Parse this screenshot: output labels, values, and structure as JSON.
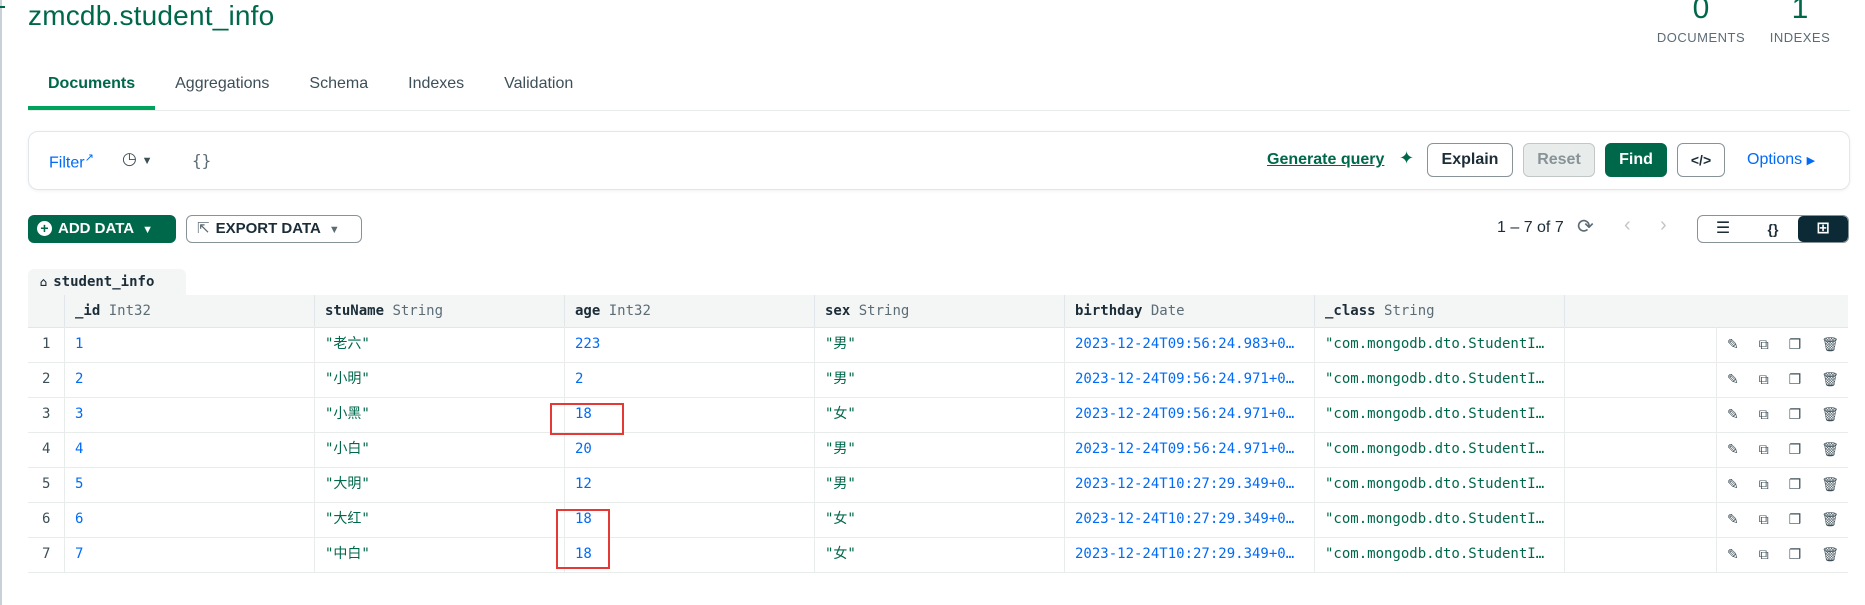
{
  "header": {
    "title": "zmcdb.student_info",
    "documents_count": "0",
    "documents_label": "DOCUMENTS",
    "indexes_count": "1",
    "indexes_label": "INDEXES"
  },
  "tabs": [
    {
      "label": "Documents",
      "active": true
    },
    {
      "label": "Aggregations"
    },
    {
      "label": "Schema"
    },
    {
      "label": "Indexes"
    },
    {
      "label": "Validation"
    }
  ],
  "querybar": {
    "filter_label": "Filter",
    "filter_value": "{}",
    "generate_query": "Generate query",
    "explain": "Explain",
    "reset": "Reset",
    "find": "Find",
    "options": "Options"
  },
  "toolbar": {
    "add_data": "ADD DATA",
    "export_data": "EXPORT DATA",
    "pagination": "1 – 7 of 7"
  },
  "grid": {
    "collection_tab": "student_info",
    "columns": [
      {
        "name": "_id",
        "type": "Int32"
      },
      {
        "name": "stuName",
        "type": "String"
      },
      {
        "name": "age",
        "type": "Int32"
      },
      {
        "name": "sex",
        "type": "String"
      },
      {
        "name": "birthday",
        "type": "Date"
      },
      {
        "name": "_class",
        "type": "String"
      }
    ],
    "rows": [
      {
        "idx": "1",
        "id": "1",
        "name": "\"老六\"",
        "age": "223",
        "sex": "\"男\"",
        "birthday": "2023-12-24T09:56:24.983+0…",
        "class": "\"com.mongodb.dto.StudentI…"
      },
      {
        "idx": "2",
        "id": "2",
        "name": "\"小明\"",
        "age": "2",
        "sex": "\"男\"",
        "birthday": "2023-12-24T09:56:24.971+0…",
        "class": "\"com.mongodb.dto.StudentI…"
      },
      {
        "idx": "3",
        "id": "3",
        "name": "\"小黑\"",
        "age": "18",
        "sex": "\"女\"",
        "birthday": "2023-12-24T09:56:24.971+0…",
        "class": "\"com.mongodb.dto.StudentI…"
      },
      {
        "idx": "4",
        "id": "4",
        "name": "\"小白\"",
        "age": "20",
        "sex": "\"男\"",
        "birthday": "2023-12-24T09:56:24.971+0…",
        "class": "\"com.mongodb.dto.StudentI…"
      },
      {
        "idx": "5",
        "id": "5",
        "name": "\"大明\"",
        "age": "12",
        "sex": "\"男\"",
        "birthday": "2023-12-24T10:27:29.349+0…",
        "class": "\"com.mongodb.dto.StudentI…"
      },
      {
        "idx": "6",
        "id": "6",
        "name": "\"大红\"",
        "age": "18",
        "sex": "\"女\"",
        "birthday": "2023-12-24T10:27:29.349+0…",
        "class": "\"com.mongodb.dto.StudentI…"
      },
      {
        "idx": "7",
        "id": "7",
        "name": "\"中白\"",
        "age": "18",
        "sex": "\"女\"",
        "birthday": "2023-12-24T10:27:29.349+0…",
        "class": "\"com.mongodb.dto.StudentI…"
      }
    ]
  },
  "colors": {
    "brand_green": "#00684a",
    "link_blue": "#016bf8",
    "highlight_red": "#e53935"
  }
}
